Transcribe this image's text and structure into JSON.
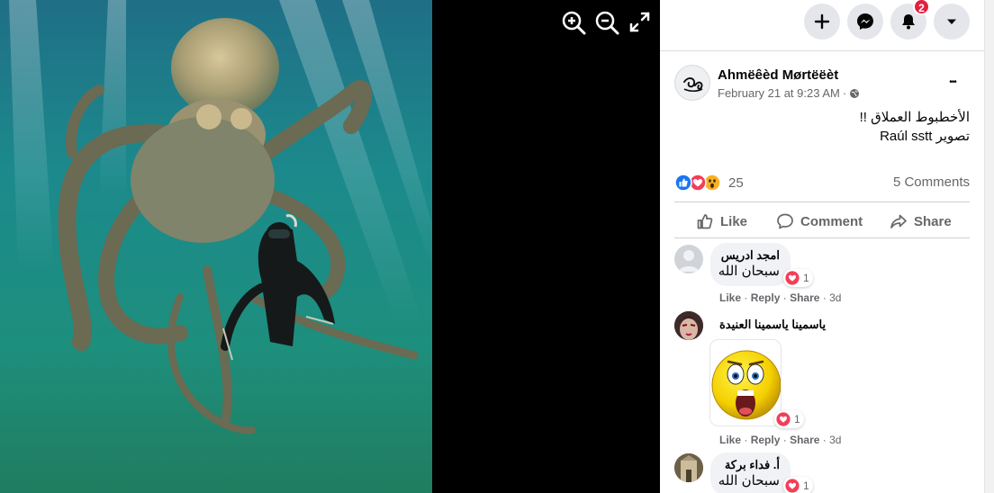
{
  "viewer": {
    "zoom_in_icon": "zoom-in-icon",
    "zoom_out_icon": "zoom-out-icon",
    "fullscreen_icon": "fullscreen-icon"
  },
  "topbar": {
    "icons": [
      "plus-icon",
      "messenger-icon",
      "bell-icon",
      "caret-down-icon"
    ],
    "notifications_count": "2"
  },
  "post": {
    "author": "Ahmëêèd Mørtëëèt",
    "date": "February 21 at 9:23 AM",
    "separator": "·",
    "line1": "الأخطبوط العملاق !!",
    "line2": "تصوير Raúl sstt",
    "reactions_count": "25",
    "comments_count": "5 Comments",
    "more": "•••"
  },
  "actions": {
    "like": "Like",
    "comment": "Comment",
    "share": "Share"
  },
  "comments": [
    {
      "name": "امجد ادريس",
      "text": "سبحان الله",
      "reaction_count": "1",
      "like": "Like",
      "reply": "Reply",
      "share": "Share",
      "time": "3d",
      "sep": "·"
    },
    {
      "name": "ياسمينا ياسمينا العنيدة",
      "text": "",
      "reaction_count": "1",
      "like": "Like",
      "reply": "Reply",
      "share": "Share",
      "time": "3d",
      "sep": "·"
    },
    {
      "name": "أ. فداء بركة",
      "text": "سبحان الله",
      "reaction_count": "1"
    }
  ],
  "colors": {
    "accent": "#1877f2",
    "love": "#f33e58",
    "badge": "#e41e3f",
    "text": "#050505",
    "secondary": "#65676b"
  }
}
